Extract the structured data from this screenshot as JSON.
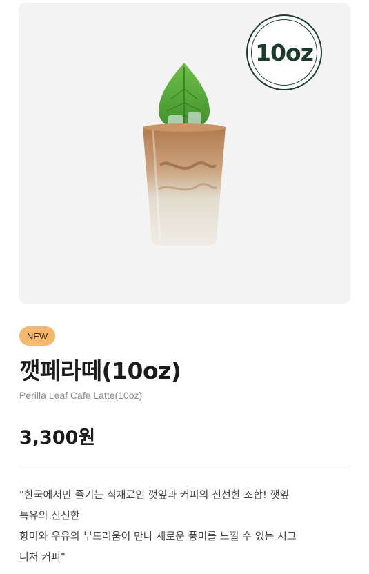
{
  "product": {
    "size_badge": "10oz",
    "badge": "NEW",
    "name": "깻페라떼(10oz)",
    "english_name": "Perilla Leaf Cafe Latte(10oz)",
    "price": "3,300원",
    "description_lines": [
      "\"한국에서만 즐기는 식재료인 깻잎과 커피의 신선한 조합! 깻잎",
      "특유의 신선한",
      "향미와 우유의 부드러움이 만나 새로운 풍미를 느낄 수 있는 시그",
      "니처 커피\""
    ]
  },
  "colors": {
    "hero_bg": "#f3f3f3",
    "badge_new_bg": "#f6b86a",
    "size_badge": "#1d3b2a"
  }
}
